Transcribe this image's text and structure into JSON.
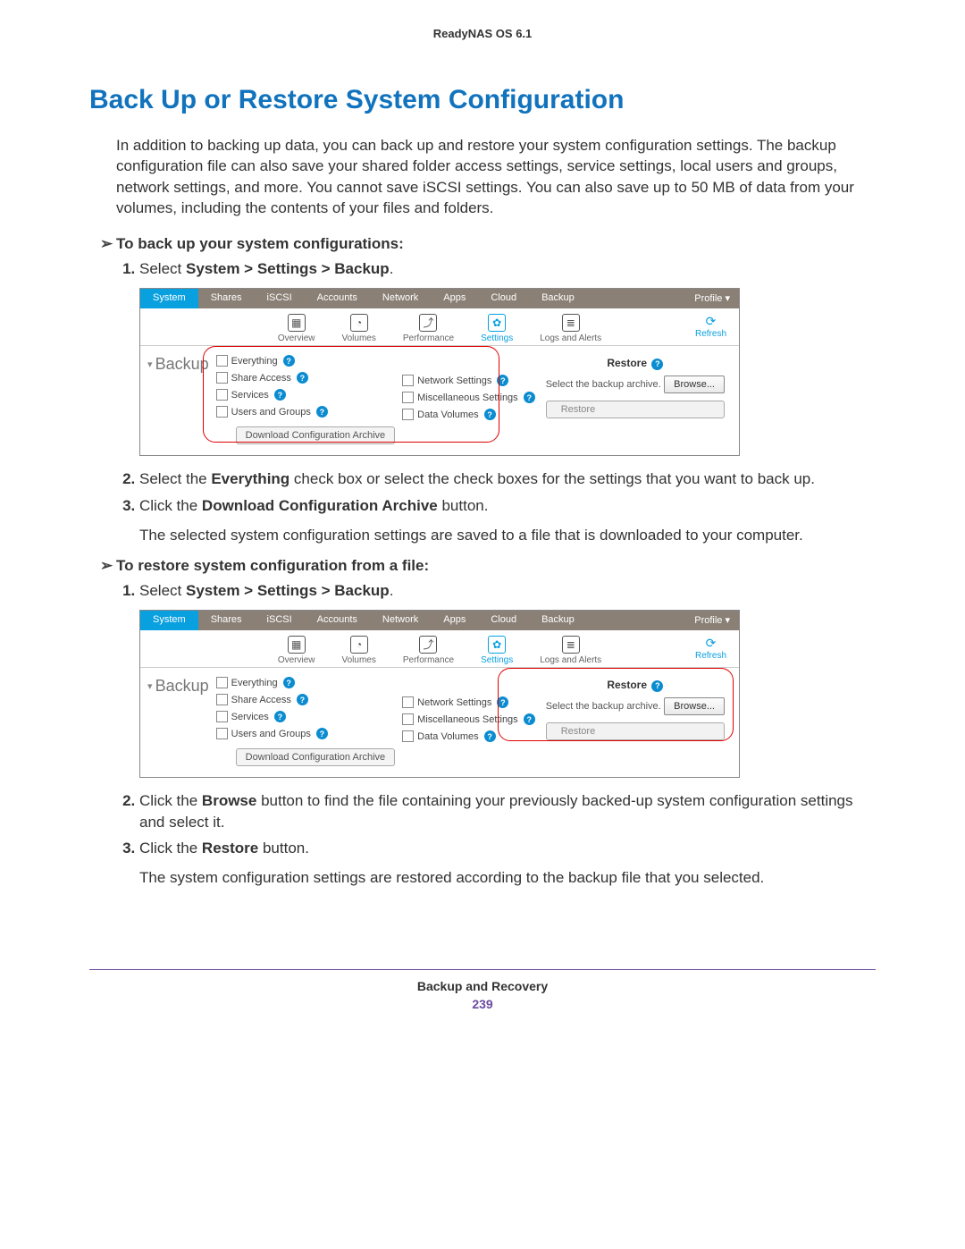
{
  "header": {
    "product": "ReadyNAS OS 6.1"
  },
  "title": "Back Up or Restore System Configuration",
  "intro": "In addition to backing up data, you can back up and restore your system configuration settings. The backup configuration file can also save your shared folder access settings, service settings, local users and groups, network settings, and more. You cannot save iSCSI settings. You can also save up to 50 MB of data from your volumes, including the contents of your files and folders.",
  "procedures": {
    "backup": {
      "heading": "To back up your system configurations:",
      "step1_pre": "Select ",
      "step1_bold": "System > Settings > Backup",
      "step1_post": ".",
      "step2_a": "Select the ",
      "step2_bold": "Everything",
      "step2_b": " check box or select the check boxes for the settings that you want to back up.",
      "step3_pre": "Click the ",
      "step3_bold": "Download Configuration Archive",
      "step3_post": " button.",
      "step3_note": "The selected system configuration settings are saved to a file that is downloaded to your computer."
    },
    "restore": {
      "heading": "To restore system configuration from a file:",
      "step1_pre": "Select ",
      "step1_bold": "System > Settings > Backup",
      "step1_post": ".",
      "step2_a": "Click the ",
      "step2_bold1": "Browse",
      "step2_b": " button to find the file containing your previously backed-up system configuration settings and select it.",
      "step3_pre": "Click the ",
      "step3_bold": "Restore",
      "step3_post": " button.",
      "step3_note": "The system configuration settings are restored according to the backup file that you selected."
    }
  },
  "screenshot": {
    "nav_tabs": [
      "System",
      "Shares",
      "iSCSI",
      "Accounts",
      "Network",
      "Apps",
      "Cloud",
      "Backup"
    ],
    "nav_profile": "Profile ▾",
    "toolbar": {
      "overview": "Overview",
      "volumes": "Volumes",
      "performance": "Performance",
      "settings": "Settings",
      "logs": "Logs and Alerts",
      "refresh": "Refresh"
    },
    "section_label": "Backup",
    "checkboxes_left": [
      "Everything",
      "Share Access",
      "Services",
      "Users and Groups"
    ],
    "checkboxes_right": [
      "Network Settings",
      "Miscellaneous Settings",
      "Data Volumes"
    ],
    "download_btn": "Download Configuration Archive",
    "restore_title": "Restore",
    "restore_prompt": "Select the backup archive.",
    "browse_btn": "Browse...",
    "restore_btn": "Restore"
  },
  "footer": {
    "section": "Backup and Recovery",
    "page": "239"
  }
}
